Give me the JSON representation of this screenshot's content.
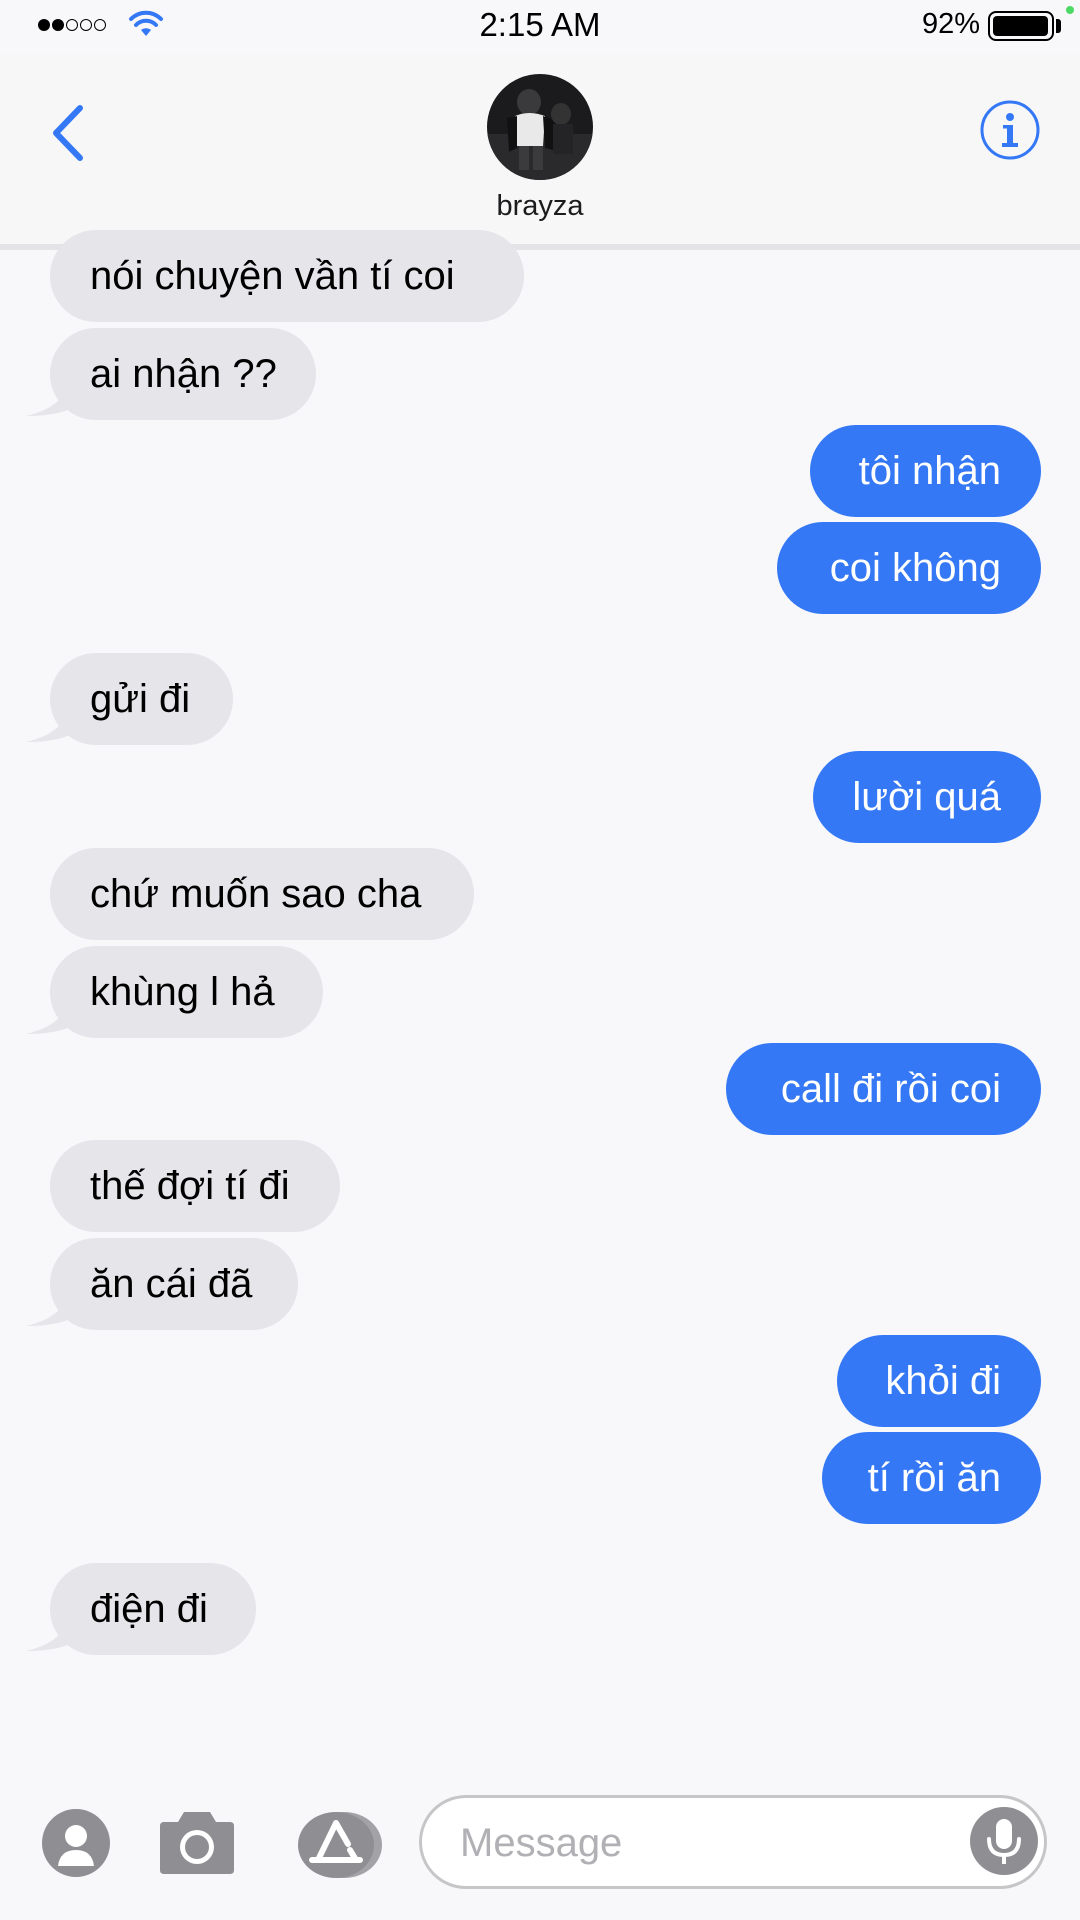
{
  "status_bar": {
    "time": "2:15 AM",
    "battery": "92%",
    "signal_bars_filled": 2,
    "signal_bars_total": 5
  },
  "header": {
    "contact_name": "brayza"
  },
  "messages": [
    {
      "side": "in",
      "text": "nói chuyện vần tí coi"
    },
    {
      "side": "in",
      "text": "ai nhận ??"
    },
    {
      "side": "out",
      "text": "tôi nhận"
    },
    {
      "side": "out",
      "text": "coi không"
    },
    {
      "side": "in",
      "text": "gửi đi"
    },
    {
      "side": "out",
      "text": "lười quá"
    },
    {
      "side": "in",
      "text": "chứ muốn sao cha"
    },
    {
      "side": "in",
      "text": "khùng l hả"
    },
    {
      "side": "out",
      "text": "call đi rồi coi"
    },
    {
      "side": "in",
      "text": "thế đợi tí đi"
    },
    {
      "side": "in",
      "text": "ăn cái đã"
    },
    {
      "side": "out",
      "text": "khỏi đi"
    },
    {
      "side": "out",
      "text": "tí rồi ăn"
    },
    {
      "side": "in",
      "text": "điện đi"
    }
  ],
  "input_bar": {
    "placeholder": "Message",
    "icons": [
      "contacts-apps-icon",
      "camera-icon",
      "app-store-icon",
      "microphone-icon"
    ]
  },
  "colors": {
    "accent": "#3478f6",
    "incoming_bubble": "#e5e5ea",
    "background": "#f8f8fa"
  }
}
